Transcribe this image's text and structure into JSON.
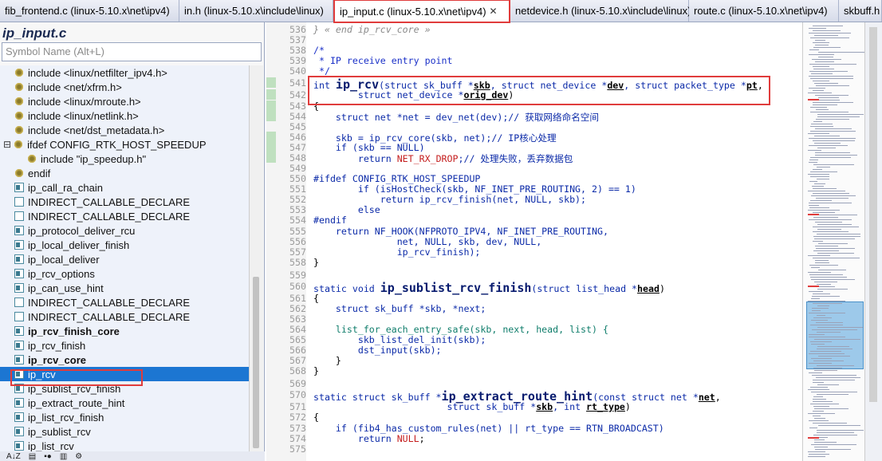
{
  "tabs": [
    {
      "label": "fib_frontend.c (linux-5.10.x\\net\\ipv4)",
      "active": false
    },
    {
      "label": "in.h (linux-5.10.x\\include\\linux)",
      "active": false
    },
    {
      "label": "ip_input.c (linux-5.10.x\\net\\ipv4)",
      "active": true
    },
    {
      "label": "netdevice.h (linux-5.10.x\\include\\linux)",
      "active": false
    },
    {
      "label": "route.c (linux-5.10.x\\net\\ipv4)",
      "active": false
    },
    {
      "label": "skbuff.h",
      "active": false
    }
  ],
  "tab_close_glyph": "✕",
  "sidebar": {
    "file_title": "ip_input.c",
    "symbol_placeholder": "Symbol Name (Alt+L)",
    "items": [
      {
        "label": "include <linux/netfilter_ipv4.h>",
        "kind": "include"
      },
      {
        "label": "include <net/xfrm.h>",
        "kind": "include"
      },
      {
        "label": "include <linux/mroute.h>",
        "kind": "include"
      },
      {
        "label": "include <linux/netlink.h>",
        "kind": "include"
      },
      {
        "label": "include <net/dst_metadata.h>",
        "kind": "include"
      },
      {
        "label": "ifdef CONFIG_RTK_HOST_SPEEDUP",
        "kind": "ifdef"
      },
      {
        "label": "include \"ip_speedup.h\"",
        "kind": "include-nested"
      },
      {
        "label": "endif",
        "kind": "include"
      },
      {
        "label": "ip_call_ra_chain",
        "kind": "function"
      },
      {
        "label": "INDIRECT_CALLABLE_DECLARE",
        "kind": "macro"
      },
      {
        "label": "INDIRECT_CALLABLE_DECLARE",
        "kind": "macro"
      },
      {
        "label": "ip_protocol_deliver_rcu",
        "kind": "function"
      },
      {
        "label": "ip_local_deliver_finish",
        "kind": "function"
      },
      {
        "label": "ip_local_deliver",
        "kind": "function"
      },
      {
        "label": "ip_rcv_options",
        "kind": "function"
      },
      {
        "label": "ip_can_use_hint",
        "kind": "function"
      },
      {
        "label": "INDIRECT_CALLABLE_DECLARE",
        "kind": "macro"
      },
      {
        "label": "INDIRECT_CALLABLE_DECLARE",
        "kind": "macro"
      },
      {
        "label": "ip_rcv_finish_core",
        "kind": "function-bold"
      },
      {
        "label": "ip_rcv_finish",
        "kind": "function"
      },
      {
        "label": "ip_rcv_core",
        "kind": "function-bold"
      },
      {
        "label": "ip_rcv",
        "kind": "function-selected"
      },
      {
        "label": "ip_sublist_rcv_finish",
        "kind": "function"
      },
      {
        "label": "ip_extract_route_hint",
        "kind": "function"
      },
      {
        "label": "ip_list_rcv_finish",
        "kind": "function"
      },
      {
        "label": "ip_sublist_rcv",
        "kind": "function"
      },
      {
        "label": "ip_list_rcv",
        "kind": "function"
      }
    ],
    "toolbar": {
      "sort_label": "A↓Z"
    }
  },
  "code": {
    "lines": [
      {
        "n": "536",
        "html_key": "l536"
      },
      {
        "n": "537"
      },
      {
        "n": "538"
      },
      {
        "n": "539"
      },
      {
        "n": "540"
      },
      {
        "n": "541"
      },
      {
        "n": "542"
      },
      {
        "n": "543"
      },
      {
        "n": "544"
      },
      {
        "n": "545"
      },
      {
        "n": "546"
      },
      {
        "n": "547"
      },
      {
        "n": "548"
      },
      {
        "n": "549"
      },
      {
        "n": "550"
      },
      {
        "n": "551"
      },
      {
        "n": "552"
      },
      {
        "n": "553"
      },
      {
        "n": "554"
      },
      {
        "n": "555"
      },
      {
        "n": "556"
      },
      {
        "n": "557"
      },
      {
        "n": "558"
      },
      {
        "n": "559"
      },
      {
        "n": "560"
      },
      {
        "n": "561"
      },
      {
        "n": "562"
      },
      {
        "n": "563"
      },
      {
        "n": "564"
      },
      {
        "n": "565"
      },
      {
        "n": "566"
      },
      {
        "n": "567"
      },
      {
        "n": "568"
      },
      {
        "n": "569"
      },
      {
        "n": "570"
      },
      {
        "n": "571"
      },
      {
        "n": "572"
      },
      {
        "n": "573"
      },
      {
        "n": "574"
      },
      {
        "n": "575"
      }
    ],
    "text": {
      "l536": "} « end ip_rcv_core »",
      "l538": "/*",
      "l539": " * IP receive entry point",
      "l540": " */",
      "l541_int": "int ",
      "l541_fn": "ip_rcv",
      "l541_rest_a": "(struct sk_buff *",
      "l541_skb": "skb",
      "l541_rest_b": ", struct net_device *",
      "l541_dev": "dev",
      "l541_rest_c": ", struct packet_type *",
      "l541_pt": "pt",
      "l541_rest_d": ",",
      "l542_a": "        struct net_device *",
      "l542_od": "orig_dev",
      "l542_b": ")",
      "l543": "{",
      "l544": "    struct net *net = dev_net(dev);// 获取网络命名空间",
      "l546": "    skb = ip_rcv_core(skb, net);// IP核心处理",
      "l547": "    if (skb == NULL)",
      "l548_a": "        return ",
      "l548_m": "NET_RX_DROP",
      "l548_b": ";// 处理失败，丢弃数据包",
      "l550": "#ifdef CONFIG_RTK_HOST_SPEEDUP",
      "l551": "        if (isHostCheck(skb, NF_INET_PRE_ROUTING, 2) == 1)",
      "l552": "            return ip_rcv_finish(net, NULL, skb);",
      "l553": "        else",
      "l554": "#endif",
      "l555": "    return NF_HOOK(NFPROTO_IPV4, NF_INET_PRE_ROUTING,",
      "l556": "               net, NULL, skb, dev, NULL,",
      "l557": "               ip_rcv_finish);",
      "l558": "}",
      "l560_a": "static void ",
      "l560_fn": "ip_sublist_rcv_finish",
      "l560_b": "(struct list_head *",
      "l560_p": "head",
      "l560_c": ")",
      "l561": "{",
      "l562": "    struct sk_buff *skb, *next;",
      "l564": "    list_for_each_entry_safe(skb, next, head, list) {",
      "l565": "        skb_list_del_init(skb);",
      "l566": "        dst_input(skb);",
      "l567": "    }",
      "l568": "}",
      "l570_a": "static struct sk_buff *",
      "l570_fn": "ip_extract_route_hint",
      "l570_b": "(const struct net *",
      "l570_p": "net",
      "l570_c": ",",
      "l571_a": "                        struct sk_buff *",
      "l571_p1": "skb",
      "l571_b": ", int ",
      "l571_p2": "rt_type",
      "l571_c": ")",
      "l572": "{",
      "l573": "    if (fib4_has_custom_rules(net) || rt_type == RTN_BROADCAST)",
      "l574_a": "        return ",
      "l574_m": "NULL",
      "l574_b": ";"
    }
  },
  "colors": {
    "accent_red": "#e03c3c",
    "selection_blue": "#1c76d2",
    "minimap_view": "#50a0dc"
  }
}
